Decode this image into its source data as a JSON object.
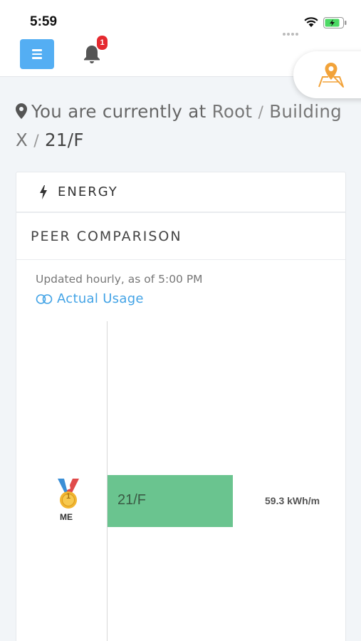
{
  "status_bar": {
    "time": "5:59"
  },
  "header": {
    "notification_count": "1"
  },
  "location": {
    "prefix": "You are currently at",
    "path": [
      "Root",
      "Building X",
      "21/F"
    ],
    "separator": "/"
  },
  "card": {
    "energy_label": "ENERGY",
    "section_label": "PEER COMPARISON",
    "updated_text": "Updated hourly, as of 5:00 PM",
    "toggle_label": "Actual Usage"
  },
  "colors": {
    "bar": "#6ac48f",
    "accent": "#54aef3",
    "link": "#42a3e6",
    "badge": "#e5292f"
  },
  "chart_data": {
    "type": "bar",
    "orientation": "horizontal",
    "categories": [
      "21/F"
    ],
    "values": [
      59.3
    ],
    "value_labels": [
      "59.3 kWh/m"
    ],
    "rank_label": "ME",
    "rank": "1",
    "xmax": 135
  }
}
